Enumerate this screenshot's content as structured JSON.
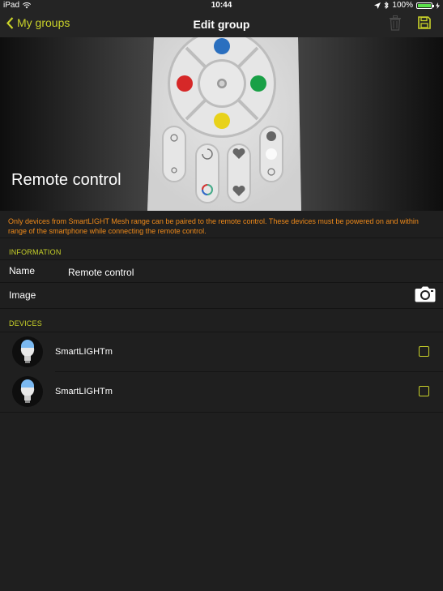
{
  "status": {
    "device": "iPad",
    "time": "10:44",
    "battery": "100%",
    "battery_level": 1.0
  },
  "nav": {
    "back_label": "My groups",
    "title": "Edit group"
  },
  "hero": {
    "title": "Remote control"
  },
  "notice": "Only devices from SmartLIGHT Mesh range can be paired to the remote control. These devices must be powered on and within range of the smartphone while connecting the remote control.",
  "info": {
    "header": "INFORMATION",
    "name_label": "Name",
    "name_value": "Remote control",
    "image_label": "Image"
  },
  "devices": {
    "header": "DEVICES",
    "items": [
      {
        "label": "SmartLIGHTm",
        "checked": false
      },
      {
        "label": "SmartLIGHTm",
        "checked": false
      }
    ]
  },
  "colors": {
    "accent": "#c9d229",
    "notice": "#ef8a1a",
    "background": "#1f1f1f"
  }
}
